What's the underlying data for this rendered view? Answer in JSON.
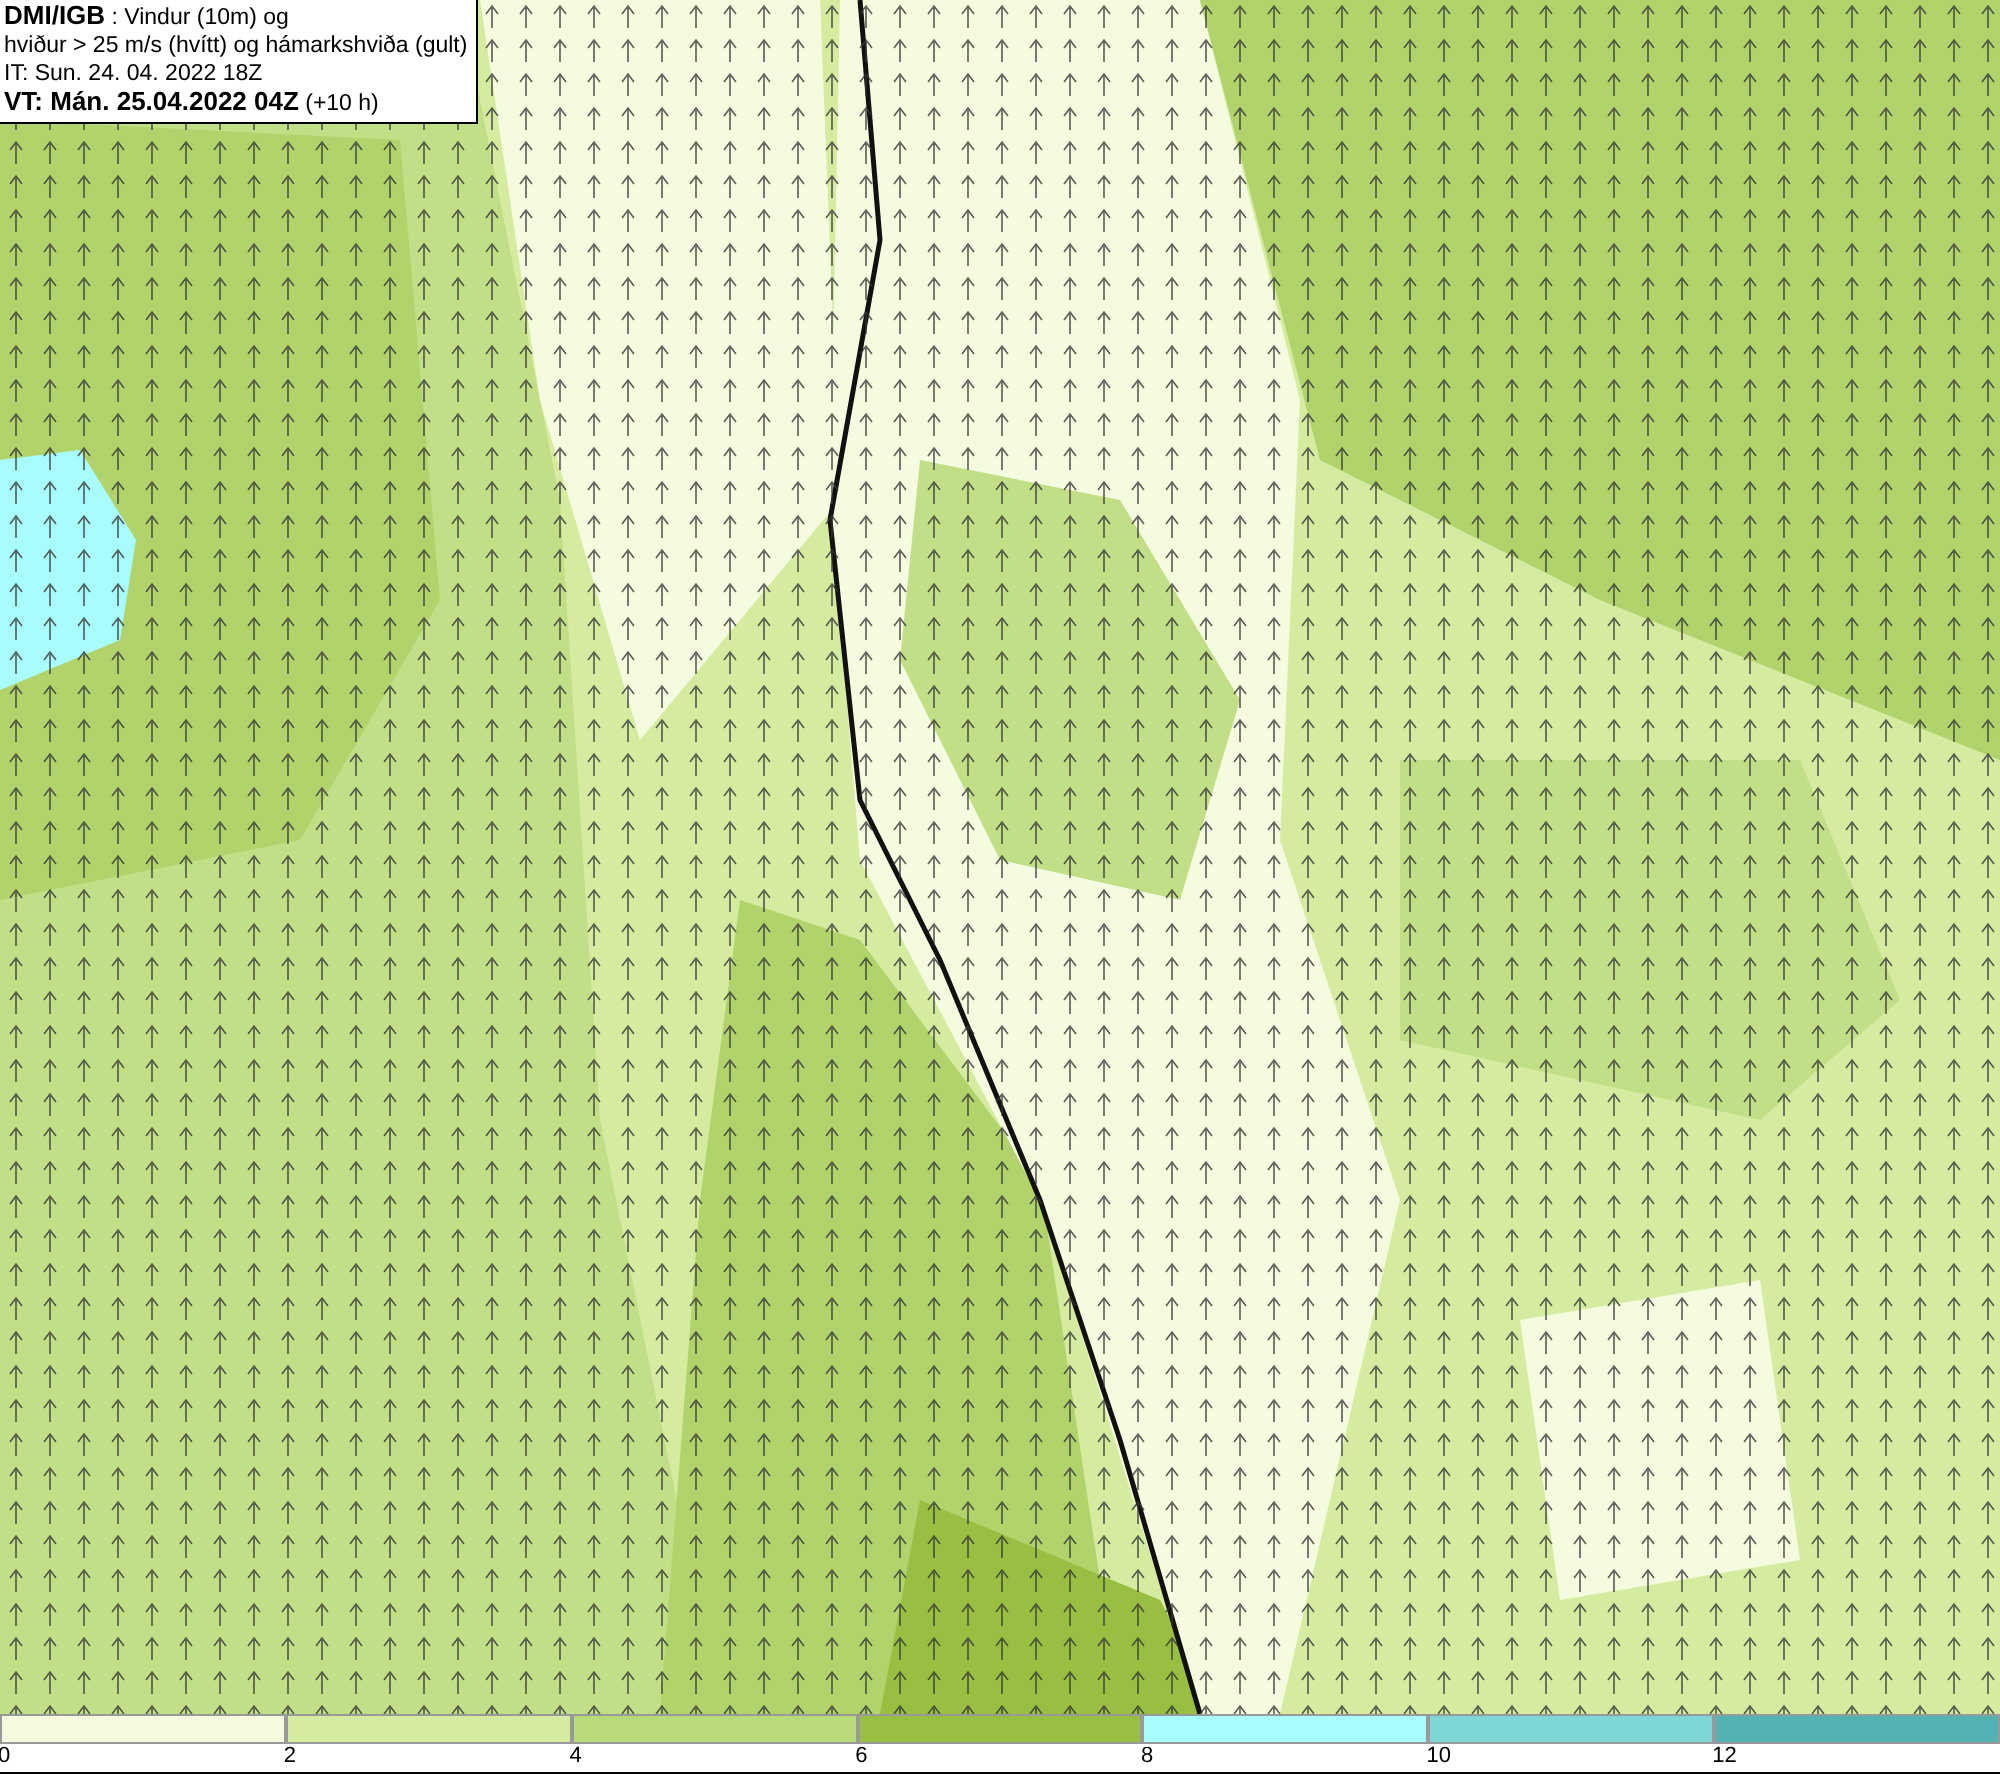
{
  "info_box": {
    "lines": [
      "**DMI/IGB** : Vindur (10m) og",
      "hviður > 25 m/s (hvítt) og hámarkshviða (gult)",
      "IT: Sun. 24. 04. 2022 18Z",
      "**VT: Mán. 25.04.2022 04Z** (+10 h)"
    ]
  },
  "legend": {
    "segments": [
      {
        "label": "0",
        "color": "#f5fbdf"
      },
      {
        "label": "2",
        "color": "#d5eca0"
      },
      {
        "label": "4",
        "color": "#b8da78"
      },
      {
        "label": "6",
        "color": "#98bf42"
      },
      {
        "label": "8",
        "color": "#a8fcfb"
      },
      {
        "label": "10",
        "color": "#7fd6d6"
      },
      {
        "label": "12",
        "color": "#55b2b2"
      }
    ]
  }
}
